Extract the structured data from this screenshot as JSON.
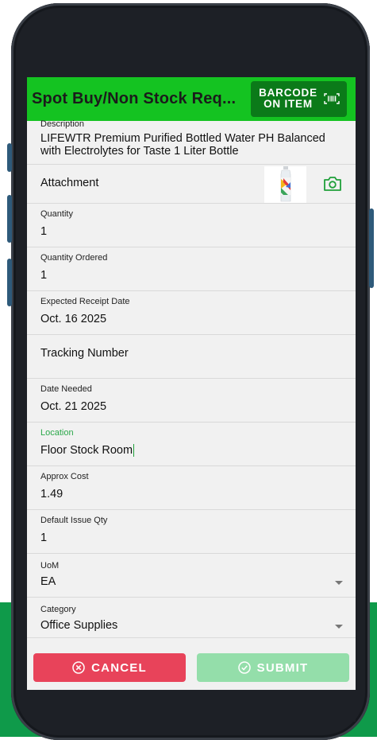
{
  "header": {
    "title": "Spot Buy/Non Stock Req...",
    "barcode_button": "BARCODE ON ITEM"
  },
  "fields": {
    "description": {
      "label": "Description",
      "value": "LIFEWTR Premium Purified Bottled Water  PH Balanced with Electrolytes for Taste  1 Liter Bottle"
    },
    "attachment": {
      "label": "Attachment"
    },
    "quantity": {
      "label": "Quantity",
      "value": "1"
    },
    "quantity_ordered": {
      "label": "Quantity Ordered",
      "value": "1"
    },
    "expected_receipt_date": {
      "label": "Expected Receipt Date",
      "value": "Oct. 16 2025"
    },
    "tracking_number": {
      "label": "Tracking Number"
    },
    "date_needed": {
      "label": "Date Needed",
      "value": "Oct. 21 2025"
    },
    "location": {
      "label": "Location",
      "value": "Floor Stock Room"
    },
    "approx_cost": {
      "label": "Approx Cost",
      "value": "1.49"
    },
    "default_issue_qty": {
      "label": "Default Issue Qty",
      "value": "1"
    },
    "uom": {
      "label": "UoM",
      "value": "EA"
    },
    "category": {
      "label": "Category",
      "value": "Office Supplies"
    }
  },
  "footer": {
    "cancel_label": "CANCEL",
    "submit_label": "SUBMIT"
  },
  "icons": {
    "barcode": "barcode-icon",
    "camera": "camera-icon",
    "cancel": "x-circle-icon",
    "submit": "check-circle-icon",
    "dropdown": "chevron-down-icon"
  },
  "colors": {
    "header_green": "#14c321",
    "barcode_button": "#0b7a19",
    "focus_label": "#2ba84a",
    "cancel_button": "#e8435a",
    "submit_button": "#94deaa",
    "background_green": "#0f9a4a",
    "screen_bg": "#f1f1f1"
  }
}
